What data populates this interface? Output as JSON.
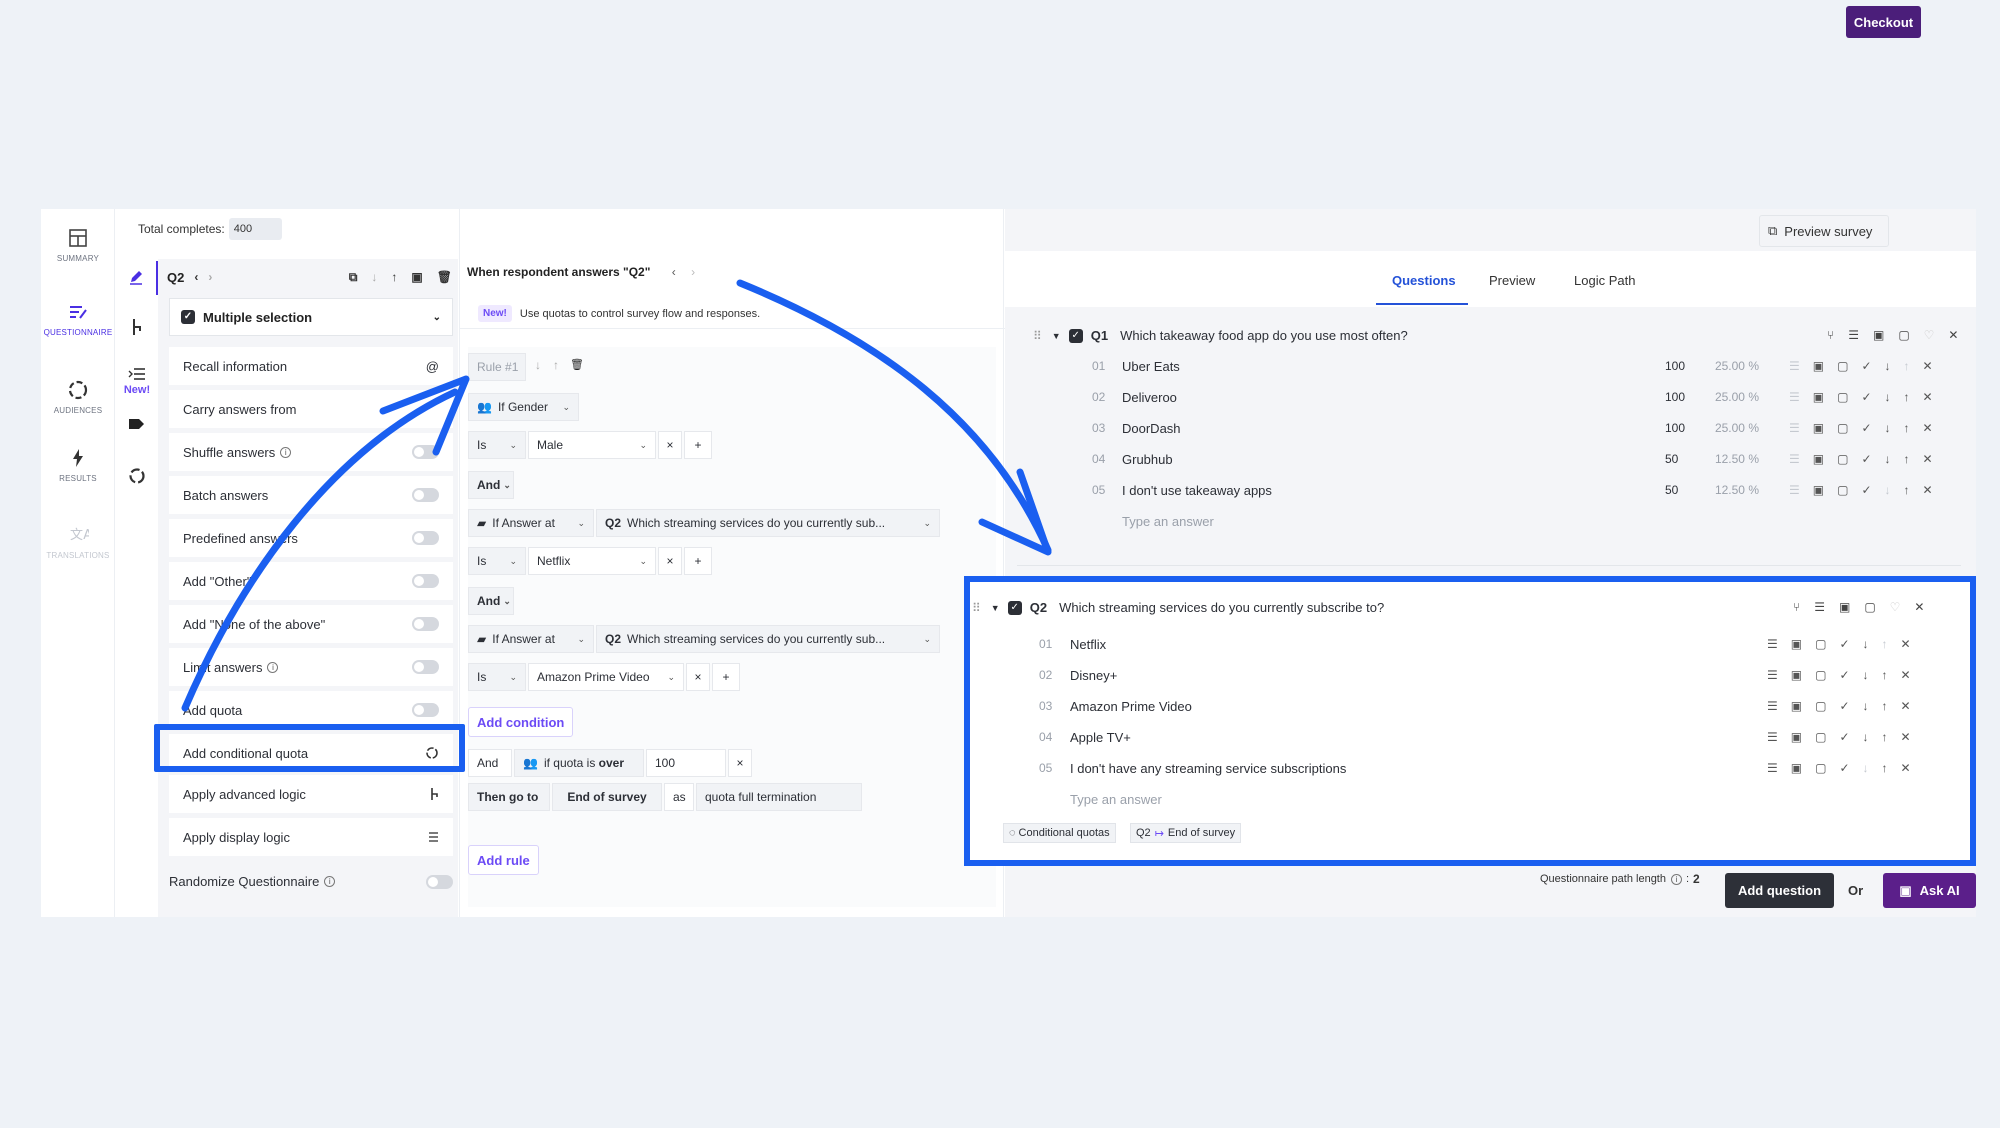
{
  "rail": {
    "items": [
      {
        "label": "SUMMARY",
        "icon": "summary-icon"
      },
      {
        "label": "QUESTIONNAIRE",
        "icon": "questionnaire-icon"
      },
      {
        "label": "AUDIENCES",
        "icon": "audiences-icon"
      },
      {
        "label": "RESULTS",
        "icon": "results-icon"
      },
      {
        "label": "TRANSLATIONS",
        "icon": "translations-icon"
      }
    ]
  },
  "subrail": {
    "new_label": "New!"
  },
  "topbar": {
    "total_label": "Total completes:",
    "total_value": "400",
    "preview_label": "Preview survey",
    "checkout_label": "Checkout"
  },
  "left_panel": {
    "question_id": "Q2",
    "type_label": "Multiple selection",
    "options": [
      {
        "label": "Recall information",
        "control": "@"
      },
      {
        "label": "Carry answers from",
        "control": ""
      },
      {
        "label": "Shuffle answers",
        "control": "toggle",
        "info": true
      },
      {
        "label": "Batch answers",
        "control": "toggle"
      },
      {
        "label": "Predefined answers",
        "control": "toggle"
      },
      {
        "label": "Add \"Other\"",
        "control": "toggle"
      },
      {
        "label": "Add \"None of the above\"",
        "control": "toggle"
      },
      {
        "label": "Limit answers",
        "control": "toggle",
        "info": true
      },
      {
        "label": "Add quota",
        "control": "toggle"
      },
      {
        "label": "Add conditional quota",
        "control": "cycle"
      },
      {
        "label": "Apply advanced logic",
        "control": "branch"
      },
      {
        "label": "Apply display logic",
        "control": "list"
      }
    ],
    "randomize_label": "Randomize Questionnaire"
  },
  "mid_panel": {
    "title": "When respondent answers \"Q2\"",
    "new_badge": "New!",
    "new_text": "Use quotas to control survey flow and responses.",
    "rule_label": "Rule #1",
    "if_gender": "If Gender",
    "is": "Is",
    "male": "Male",
    "and": "And",
    "if_answer_at": "If Answer at",
    "q2": "Q2",
    "q2_text": "Which streaming services do you currently sub...",
    "netflix": "Netflix",
    "amazon": "Amazon Prime Video",
    "add_condition": "Add condition",
    "and_plain": "And",
    "quota_prefix": "if quota is",
    "quota_over": "over",
    "quota_value": "100",
    "then_go_to": "Then go to",
    "end_of_survey": "End of survey",
    "as": "as",
    "termination": "quota full termination",
    "add_rule": "Add rule"
  },
  "tabs": [
    {
      "label": "Questions",
      "active": true
    },
    {
      "label": "Preview",
      "active": false
    },
    {
      "label": "Logic Path",
      "active": false
    }
  ],
  "questions": [
    {
      "id": "Q1",
      "text": "Which takeaway food app do you use most often?",
      "answers": [
        {
          "num": "01",
          "text": "Uber Eats",
          "quota": "100",
          "pct": "25.00 %"
        },
        {
          "num": "02",
          "text": "Deliveroo",
          "quota": "100",
          "pct": "25.00 %"
        },
        {
          "num": "03",
          "text": "DoorDash",
          "quota": "100",
          "pct": "25.00 %"
        },
        {
          "num": "04",
          "text": "Grubhub",
          "quota": "50",
          "pct": "12.50 %"
        },
        {
          "num": "05",
          "text": "I don't use takeaway apps",
          "quota": "50",
          "pct": "12.50 %"
        }
      ],
      "placeholder": "Type an answer"
    },
    {
      "id": "Q2",
      "text": "Which streaming services do you currently subscribe to?",
      "answers": [
        {
          "num": "01",
          "text": "Netflix"
        },
        {
          "num": "02",
          "text": "Disney+"
        },
        {
          "num": "03",
          "text": "Amazon Prime Video"
        },
        {
          "num": "04",
          "text": "Apple TV+"
        },
        {
          "num": "05",
          "text": "I don't have any streaming service subscriptions"
        }
      ],
      "placeholder": "Type an answer",
      "tag_quota": "Conditional quotas",
      "tag_logic_q": "Q2",
      "tag_logic_dest": "End of survey"
    }
  ],
  "footer": {
    "path_label": "Questionnaire path length",
    "path_value": "2",
    "add_question": "Add question",
    "or": "Or",
    "ask_ai": "Ask AI"
  },
  "colors": {
    "accent": "#4a2fe3",
    "highlight": "#1a5ff0",
    "checkout": "#4b1e7a"
  }
}
